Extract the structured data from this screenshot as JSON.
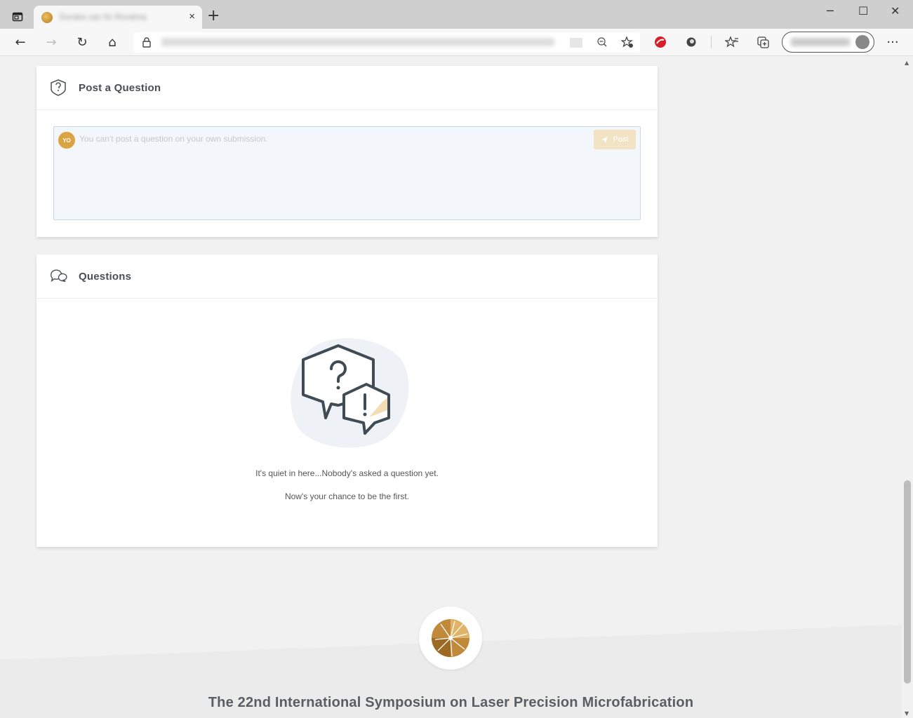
{
  "browser": {
    "tab_title": "Soraka can fix Roraima",
    "tab_close": "×",
    "new_tab": "+",
    "window_controls": {
      "minimize": "─",
      "maximize": "☐",
      "close": "✕"
    },
    "toolbar": {
      "back": "←",
      "forward": "→",
      "refresh": "↻",
      "home": "⌂",
      "more": "···"
    },
    "icons": [
      "tab-actions-icon",
      "lock-icon",
      "zoom-out-icon",
      "add-favorite-icon",
      "extension-red-icon",
      "extension-circle-icon",
      "favorites-icon",
      "collections-icon",
      "profile-icon"
    ]
  },
  "post_question": {
    "heading": "Post a Question",
    "avatar_initials": "YO",
    "placeholder": "You can't post a question on your own submission.",
    "post_label": "Post"
  },
  "questions": {
    "heading": "Questions",
    "empty_line1": "It's quiet in here...Nobody's asked a question yet.",
    "empty_line2": "Now's your chance to be the first."
  },
  "footer": {
    "title": "The 22nd International Symposium on Laser Precision Microfabrication"
  },
  "colors": {
    "accent": "#d9a441",
    "post_button_disabled": "#f1e3c3",
    "input_bg": "#f3f7fb",
    "page_bg": "#f1f1f1"
  }
}
